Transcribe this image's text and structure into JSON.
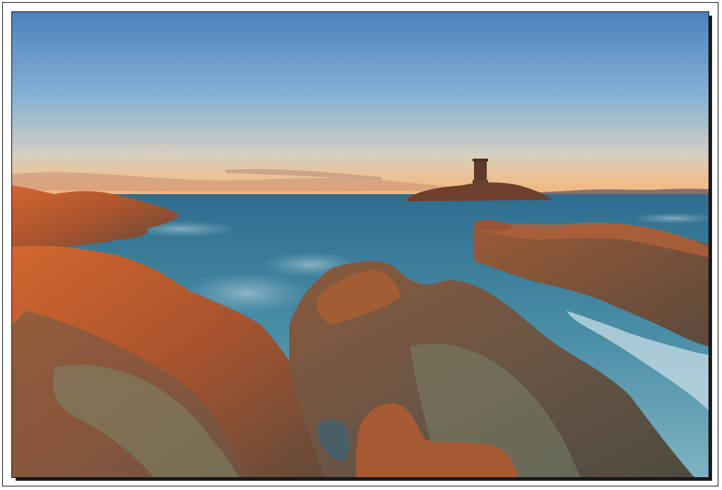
{
  "scene": {
    "subject": "coastal-sunset-with-island-tower",
    "colors": {
      "frame_background": "#ffffff",
      "frame_border": "#1a1a1a",
      "drop_shadow": "#1c1c1c",
      "sky_top": "#4e87c1",
      "sky_horizon": "#f2c48a",
      "sea": "#3f7f9c",
      "surf": "#cfe2ea",
      "rock_lit": "#c25a2c",
      "rock_shadow": "#5a4a3a",
      "lichen": "#7c8a6a"
    }
  }
}
